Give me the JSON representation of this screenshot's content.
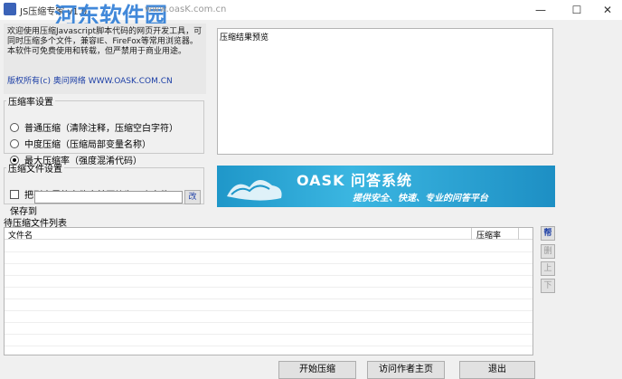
{
  "window": {
    "title": "JS压缩专家 v1.0",
    "watermark_name": "河东软件园",
    "watermark_url": "www.oasK.com.cn",
    "min_glyph": "—",
    "max_glyph": "☐",
    "close_glyph": "✕"
  },
  "info": {
    "text": "欢迎使用压缩Javascript脚本代码的网页开发工具，可同时压缩多个文件，兼容IE、FireFox等常用浏览器。本软件可免费使用和转载，但严禁用于商业用途。",
    "copyright": "版权所有(c) 奥问网络 WWW.OASK.COM.CN"
  },
  "ratio_group": {
    "legend": "压缩率设置",
    "options": [
      {
        "label": "普通压缩（清除注释，压缩空白字符）",
        "selected": false
      },
      {
        "label": "中度压缩（压缩局部变量名称）",
        "selected": false
      },
      {
        "label": "最大压缩率（强度混淆代码）",
        "selected": true
      }
    ]
  },
  "file_group": {
    "legend": "压缩文件设置",
    "merge_label": "把列表里的文件合并压缩为一个文件",
    "merge_checked": false,
    "saveto_label": "保存到",
    "saveto_value": "",
    "change_label": "改"
  },
  "preview": {
    "label": "压缩结果预览"
  },
  "banner": {
    "title": "OASK 问答系统",
    "subtitle": "提供安全、快速、专业的问答平台",
    "colors": {
      "start": "#1f97c9",
      "end": "#1d8fc4"
    }
  },
  "file_list": {
    "label": "待压缩文件列表",
    "columns": [
      "文件名",
      "压缩率"
    ],
    "rows": []
  },
  "side_buttons": {
    "help": "帮",
    "delete": "删",
    "up": "上",
    "down": "下"
  },
  "actions": {
    "start": "开始压缩",
    "visit": "访问作者主页",
    "exit": "退出"
  }
}
